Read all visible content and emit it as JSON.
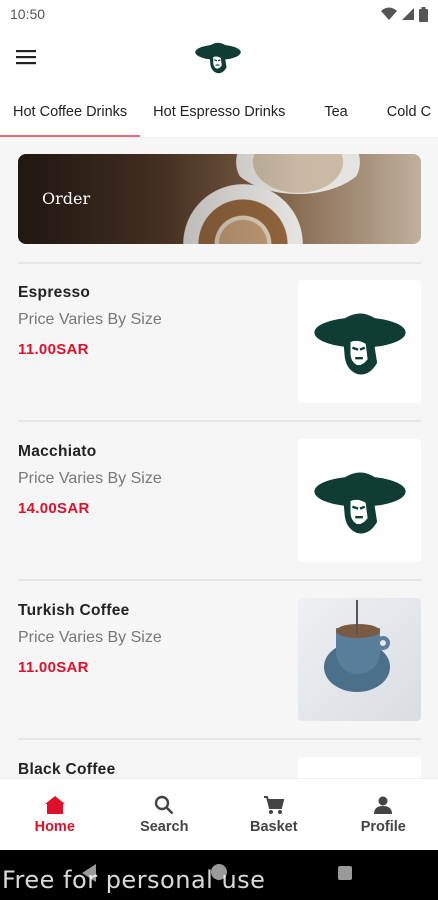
{
  "status_bar": {
    "time": "10:50",
    "icons": [
      "wifi-icon",
      "signal-icon",
      "battery-icon"
    ]
  },
  "app_bar": {
    "menu_icon": "menu-icon",
    "logo_icon": "hat-logo-icon"
  },
  "tabs": [
    {
      "label": "Hot Coffee Drinks",
      "active": true
    },
    {
      "label": "Hot Espresso Drinks",
      "active": false
    },
    {
      "label": "Tea",
      "active": false
    },
    {
      "label": "Cold C",
      "active": false
    }
  ],
  "banner": {
    "label": "Order"
  },
  "items": [
    {
      "name": "Espresso",
      "description": "Price Varies By Size",
      "price": "11.00SAR",
      "image": "hat-logo-icon"
    },
    {
      "name": "Macchiato",
      "description": "Price Varies By Size",
      "price": "14.00SAR",
      "image": "hat-logo-icon"
    },
    {
      "name": "Turkish Coffee",
      "description": "Price Varies By Size",
      "price": "11.00SAR",
      "image": "coffee-cup-photo"
    },
    {
      "name": "Black Coffee",
      "description": "",
      "price": "",
      "image": ""
    }
  ],
  "bottom_nav": [
    {
      "label": "Home",
      "icon": "home-icon",
      "active": true
    },
    {
      "label": "Search",
      "icon": "search-icon",
      "active": false
    },
    {
      "label": "Basket",
      "icon": "cart-icon",
      "active": false
    },
    {
      "label": "Profile",
      "icon": "person-icon",
      "active": false
    }
  ],
  "watermark": "Free for personal use",
  "colors": {
    "accent": "#e0102a",
    "tab_indicator": "#e86a7a",
    "logo": "#0f3d33"
  }
}
